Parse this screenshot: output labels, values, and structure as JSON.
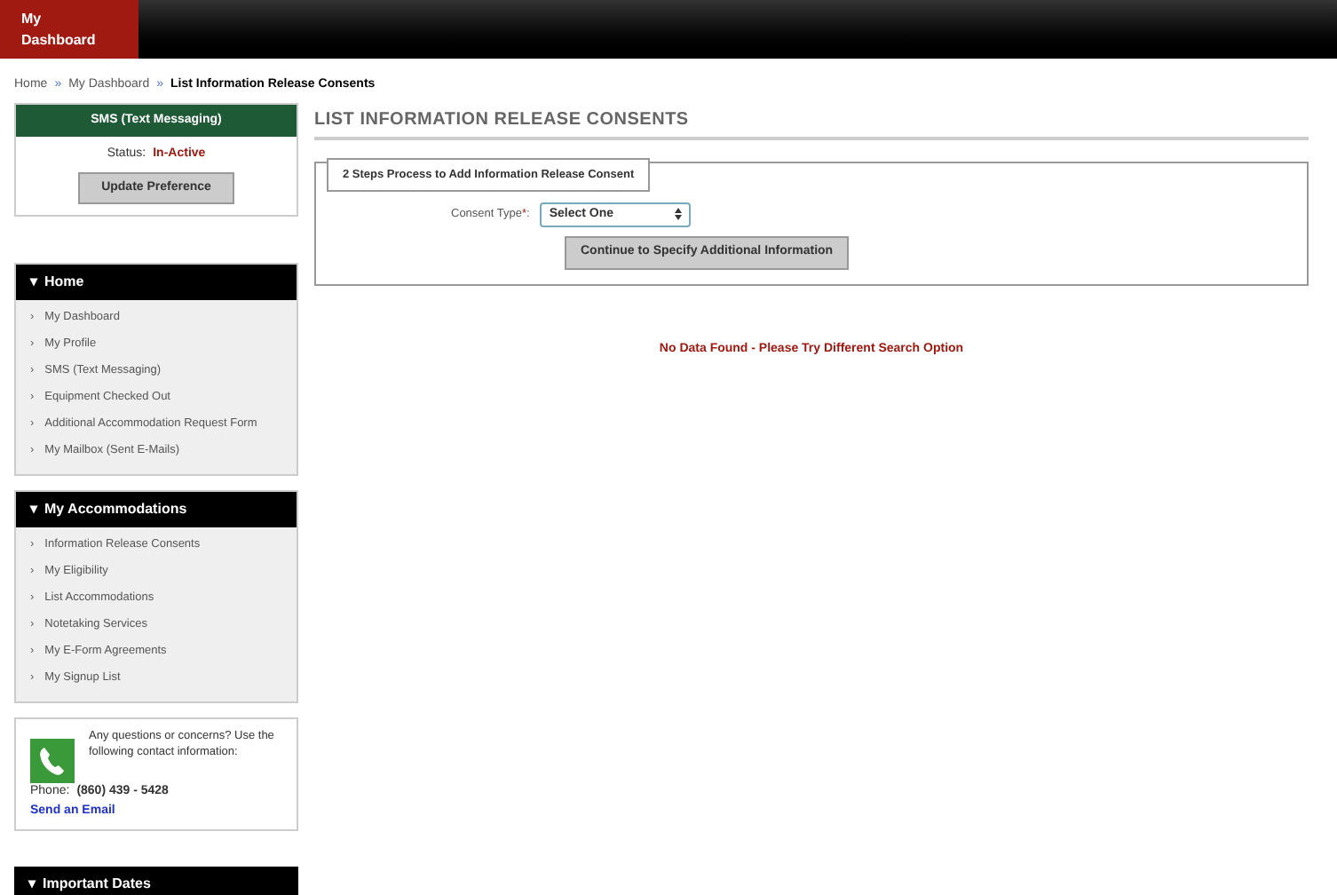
{
  "top_bar": {
    "tabs": [
      {
        "label": "My Dashboard",
        "selected": true
      }
    ]
  },
  "breadcrumb": [
    {
      "label": "Home",
      "current": false
    },
    {
      "label": "My Dashboard",
      "current": false
    },
    {
      "label": "List Information Release Consents",
      "current": true
    }
  ],
  "breadcrumb_separator": "»",
  "sidebar": {
    "sms_panel": {
      "title": "SMS (Text Messaging)",
      "status_label": "Status:",
      "status_value": "In-Active",
      "button": "Update Preference"
    },
    "menus": [
      {
        "title": "Home",
        "toggle": "▾",
        "items": [
          "My Dashboard",
          "My Profile",
          "SMS (Text Messaging)",
          "Equipment Checked Out",
          "Additional Accommodation Request Form",
          "My Mailbox (Sent E-Mails)"
        ]
      },
      {
        "title": "My Accommodations",
        "toggle": "▾",
        "items": [
          "Information Release Consents",
          "My Eligibility",
          "List Accommodations",
          "Notetaking Services",
          "My E-Form Agreements",
          "My Signup List"
        ]
      }
    ],
    "item_marker": "›",
    "contact": {
      "text": "Any questions or concerns? Use the following contact information:",
      "phone_label": "Phone:",
      "phone": "(860) 439 - 5428",
      "email_link": "Send an Email"
    },
    "dates_panel": {
      "title": "Important Dates",
      "toggle": "▾"
    }
  },
  "main": {
    "title": "LIST INFORMATION RELEASE CONSENTS",
    "fieldset_legend": "2 Steps Process to Add Information Release Consent",
    "field_label": "Consent Type",
    "required_mark": "*",
    "label_suffix": ":",
    "select_value": "Select One",
    "continue_button": "Continue to Specify Additional Information",
    "message": "No Data Found - Please Try Different Search Option"
  }
}
